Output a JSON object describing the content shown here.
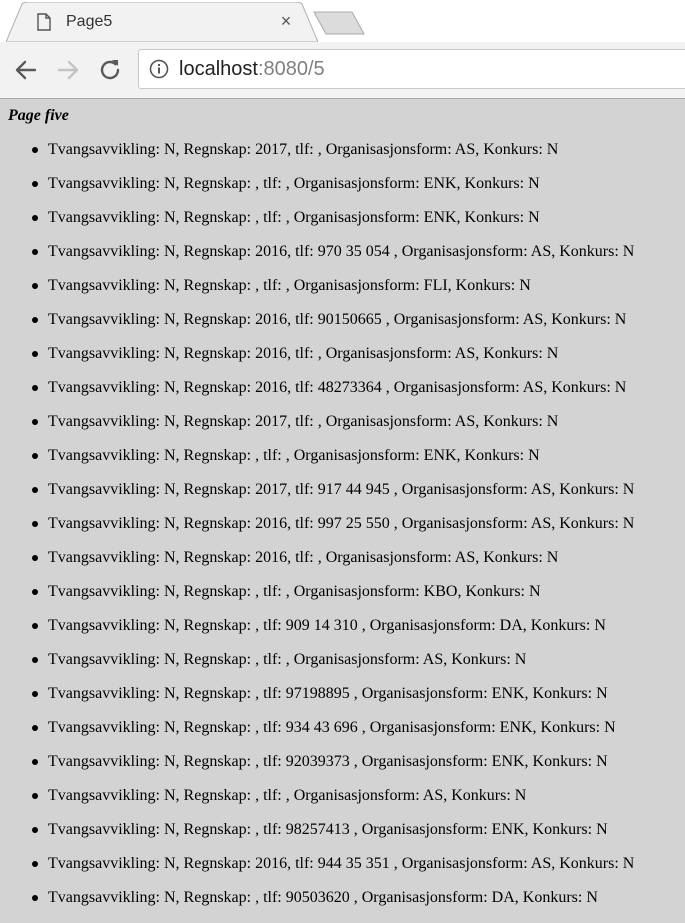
{
  "browser": {
    "tab_title": "Page5",
    "tab_close": "×",
    "url_host": "localhost",
    "url_rest": ":8080/5"
  },
  "page": {
    "title": "Page five",
    "items": [
      "Tvangsavvikling: N, Regnskap: 2017, tlf: , Organisasjonsform: AS, Konkurs: N",
      "Tvangsavvikling: N, Regnskap: , tlf: , Organisasjonsform: ENK, Konkurs: N",
      "Tvangsavvikling: N, Regnskap: , tlf: , Organisasjonsform: ENK, Konkurs: N",
      "Tvangsavvikling: N, Regnskap: 2016, tlf: 970 35 054 , Organisasjonsform: AS, Konkurs: N",
      "Tvangsavvikling: N, Regnskap: , tlf: , Organisasjonsform: FLI, Konkurs: N",
      "Tvangsavvikling: N, Regnskap: 2016, tlf: 90150665 , Organisasjonsform: AS, Konkurs: N",
      "Tvangsavvikling: N, Regnskap: 2016, tlf: , Organisasjonsform: AS, Konkurs: N",
      "Tvangsavvikling: N, Regnskap: 2016, tlf: 48273364 , Organisasjonsform: AS, Konkurs: N",
      "Tvangsavvikling: N, Regnskap: 2017, tlf: , Organisasjonsform: AS, Konkurs: N",
      "Tvangsavvikling: N, Regnskap: , tlf: , Organisasjonsform: ENK, Konkurs: N",
      "Tvangsavvikling: N, Regnskap: 2017, tlf: 917 44 945 , Organisasjonsform: AS, Konkurs: N",
      "Tvangsavvikling: N, Regnskap: 2016, tlf: 997 25 550 , Organisasjonsform: AS, Konkurs: N",
      "Tvangsavvikling: N, Regnskap: 2016, tlf: , Organisasjonsform: AS, Konkurs: N",
      "Tvangsavvikling: N, Regnskap: , tlf: , Organisasjonsform: KBO, Konkurs: N",
      "Tvangsavvikling: N, Regnskap: , tlf: 909 14 310 , Organisasjonsform: DA, Konkurs: N",
      "Tvangsavvikling: N, Regnskap: , tlf: , Organisasjonsform: AS, Konkurs: N",
      "Tvangsavvikling: N, Regnskap: , tlf: 97198895 , Organisasjonsform: ENK, Konkurs: N",
      "Tvangsavvikling: N, Regnskap: , tlf: 934 43 696 , Organisasjonsform: ENK, Konkurs: N",
      "Tvangsavvikling: N, Regnskap: , tlf: 92039373 , Organisasjonsform: ENK, Konkurs: N",
      "Tvangsavvikling: N, Regnskap: , tlf: , Organisasjonsform: AS, Konkurs: N",
      "Tvangsavvikling: N, Regnskap: , tlf: 98257413 , Organisasjonsform: ENK, Konkurs: N",
      "Tvangsavvikling: N, Regnskap: 2016, tlf: 944 35 351 , Organisasjonsform: AS, Konkurs: N",
      "Tvangsavvikling: N, Regnskap: , tlf: 90503620 , Organisasjonsform: DA, Konkurs: N"
    ]
  },
  "icons": {
    "page": "page-icon",
    "back": "back-arrow-icon",
    "forward": "forward-arrow-icon",
    "reload": "reload-icon",
    "info": "info-icon"
  }
}
